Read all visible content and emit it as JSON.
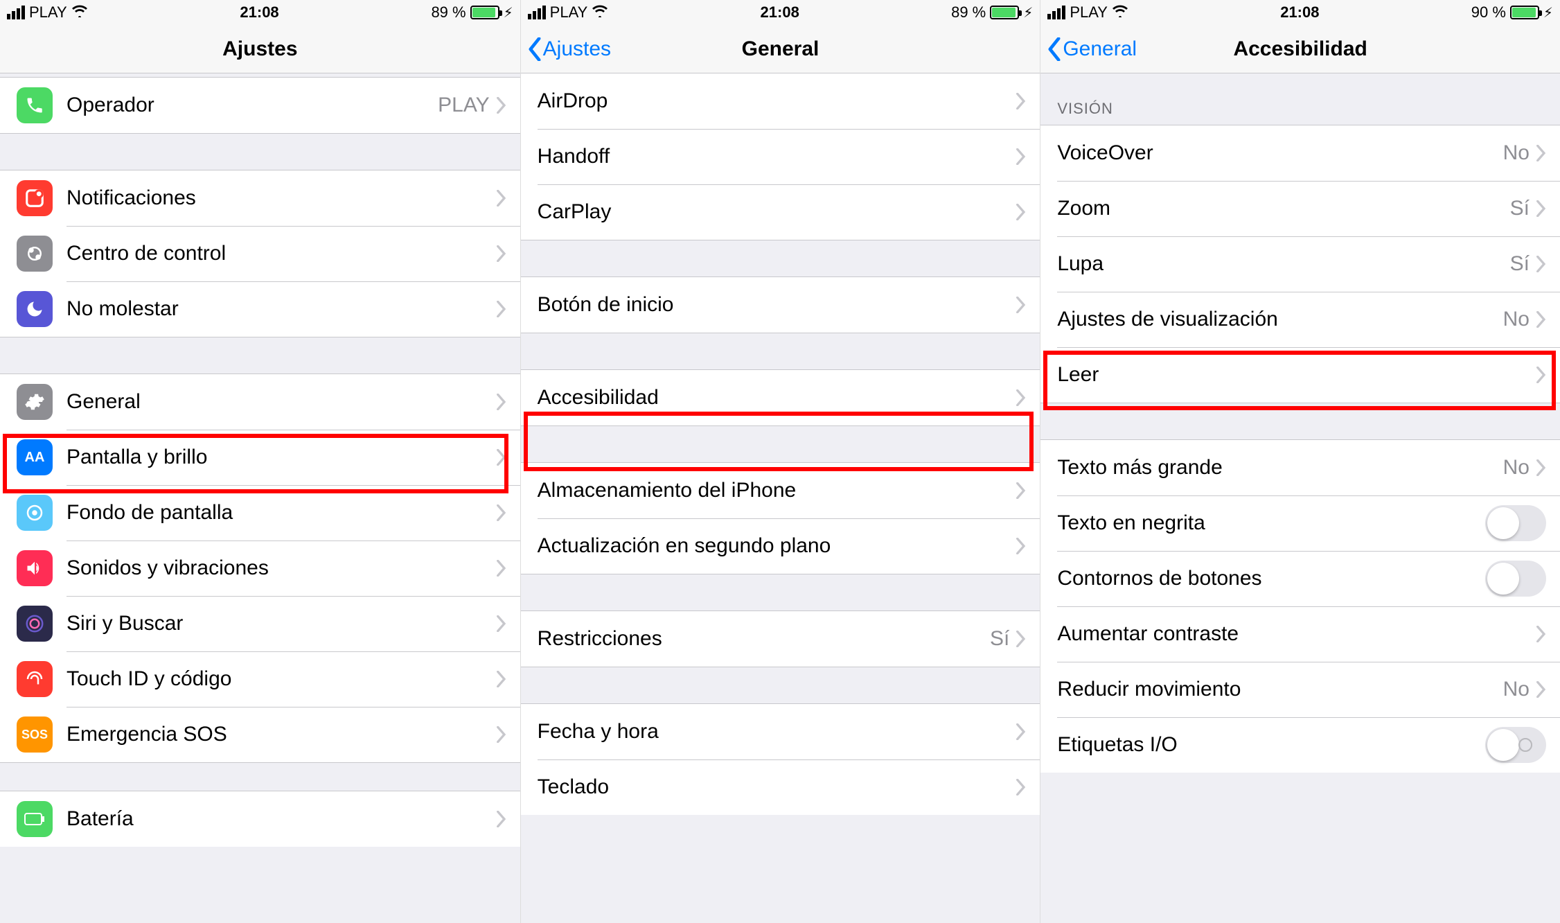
{
  "status": {
    "carrier": "PLAY",
    "time": "21:08",
    "battery1": "89 %",
    "battery2": "89 %",
    "battery3": "90 %"
  },
  "screen1": {
    "title": "Ajustes",
    "operador_label": "Operador",
    "operador_value": "PLAY",
    "notificaciones": "Notificaciones",
    "centro_control": "Centro de control",
    "no_molestar": "No molestar",
    "general": "General",
    "pantalla_brillo": "Pantalla y brillo",
    "fondo_pantalla": "Fondo de pantalla",
    "sonidos": "Sonidos y vibraciones",
    "siri": "Siri y Buscar",
    "touchid": "Touch ID y código",
    "emergencia": "Emergencia SOS",
    "bateria": "Batería",
    "sos_text": "SOS"
  },
  "screen2": {
    "back": "Ajustes",
    "title": "General",
    "airdrop": "AirDrop",
    "handoff": "Handoff",
    "carplay": "CarPlay",
    "boton_inicio": "Botón de inicio",
    "accesibilidad": "Accesibilidad",
    "almacenamiento": "Almacenamiento del iPhone",
    "actualizacion": "Actualización en segundo plano",
    "restricciones": "Restricciones",
    "restricciones_value": "Sí",
    "fecha_hora": "Fecha y hora",
    "teclado": "Teclado"
  },
  "screen3": {
    "back": "General",
    "title": "Accesibilidad",
    "section_vision": "VISIÓN",
    "voiceover": "VoiceOver",
    "voiceover_value": "No",
    "zoom": "Zoom",
    "zoom_value": "Sí",
    "lupa": "Lupa",
    "lupa_value": "Sí",
    "ajustes_vis": "Ajustes de visualización",
    "ajustes_vis_value": "No",
    "leer": "Leer",
    "texto_grande": "Texto más grande",
    "texto_grande_value": "No",
    "texto_negrita": "Texto en negrita",
    "contornos": "Contornos de botones",
    "contraste": "Aumentar contraste",
    "reducir_mov": "Reducir movimiento",
    "reducir_mov_value": "No",
    "etiquetas_io": "Etiquetas I/O"
  }
}
